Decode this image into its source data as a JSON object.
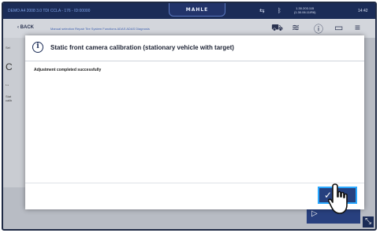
{
  "topbar": {
    "vehicle": "DEMO A4 2008 3.0 TDI CCLA - 176 - ID:00000",
    "logo": "MAHLE",
    "version_line1": "1.30.203.115",
    "version_line2": "(1.30.06.11/R6)",
    "time": "14:42"
  },
  "navbar": {
    "back_label": "BACK",
    "crumbs": "Manual selection  Repair  Tire  System  Functions  ADAS  ADAS  Diagnosis"
  },
  "dialog": {
    "title": "Static front camera calibration (stationary vehicle with target)",
    "message": "Adjustment completed successfully",
    "ok_label": "OK"
  },
  "colors": {
    "navy": "#1b2c57",
    "button": "#26407e",
    "button_focus": "#2aa8ff"
  }
}
